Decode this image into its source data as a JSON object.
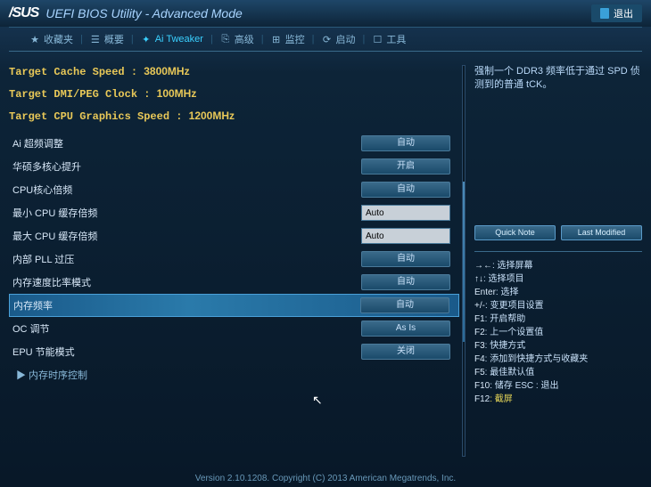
{
  "header": {
    "logo": "/SUS",
    "title": "UEFI BIOS Utility - Advanced Mode",
    "exit": "退出"
  },
  "tabs": [
    {
      "icon": "★",
      "label": "收藏夹"
    },
    {
      "icon": "☰",
      "label": "概要"
    },
    {
      "icon": "✦",
      "label": "Ai Tweaker",
      "active": true
    },
    {
      "icon": "⎘",
      "label": "高级"
    },
    {
      "icon": "⊞",
      "label": "监控"
    },
    {
      "icon": "⟳",
      "label": "启动"
    },
    {
      "icon": "☐",
      "label": "工具"
    }
  ],
  "info": [
    {
      "label": "Target Cache Speed :",
      "value": "3800MHz"
    },
    {
      "label": "Target DMI/PEG Clock :",
      "value": "100MHz"
    },
    {
      "label": "Target CPU Graphics Speed :",
      "value": "1200MHz"
    }
  ],
  "rows": [
    {
      "label": "Ai 超频调整",
      "value": "自动",
      "type": "select"
    },
    {
      "label": "华硕多核心提升",
      "value": "开启",
      "type": "select"
    },
    {
      "label": "CPU核心倍频",
      "value": "自动",
      "type": "select"
    },
    {
      "label": "最小 CPU 缓存倍频",
      "value": "Auto",
      "type": "input"
    },
    {
      "label": "最大 CPU 缓存倍频",
      "value": "Auto",
      "type": "input"
    },
    {
      "label": "内部 PLL 过压",
      "value": "自动",
      "type": "select"
    },
    {
      "label": "内存速度比率模式",
      "value": "自动",
      "type": "select"
    },
    {
      "label": "内存频率",
      "value": "自动",
      "type": "select",
      "selected": true
    },
    {
      "label": "OC 调节",
      "value": "As Is",
      "type": "select"
    },
    {
      "label": "EPU 节能模式",
      "value": "关闭",
      "type": "select"
    },
    {
      "label": "▶ 内存时序控制",
      "type": "expand"
    }
  ],
  "help": "强制一个 DDR3 频率低于通过 SPD 侦测到的普通 tCK。",
  "quick": {
    "note": "Quick Note",
    "last": "Last Modified"
  },
  "hints": [
    {
      "k": "→←",
      "v": ": 选择屏幕"
    },
    {
      "k": "↑↓",
      "v": ": 选择项目"
    },
    {
      "k": "Enter",
      "v": ": 选择"
    },
    {
      "k": "+/-",
      "v": ": 变更项目设置"
    },
    {
      "k": "F1",
      "v": ": 开启帮助"
    },
    {
      "k": "F2",
      "v": ": 上一个设置值"
    },
    {
      "k": "F3",
      "v": ": 快捷方式"
    },
    {
      "k": "F4",
      "v": ": 添加到快捷方式与收藏夹"
    },
    {
      "k": "F5",
      "v": ": 最佳默认值"
    },
    {
      "k": "F10",
      "v": ": 储存   ESC : 退出"
    },
    {
      "k": "F12",
      "v": ": 截屏",
      "cls": "screenshot"
    }
  ],
  "footer": "Version 2.10.1208. Copyright (C) 2013 American Megatrends, Inc."
}
